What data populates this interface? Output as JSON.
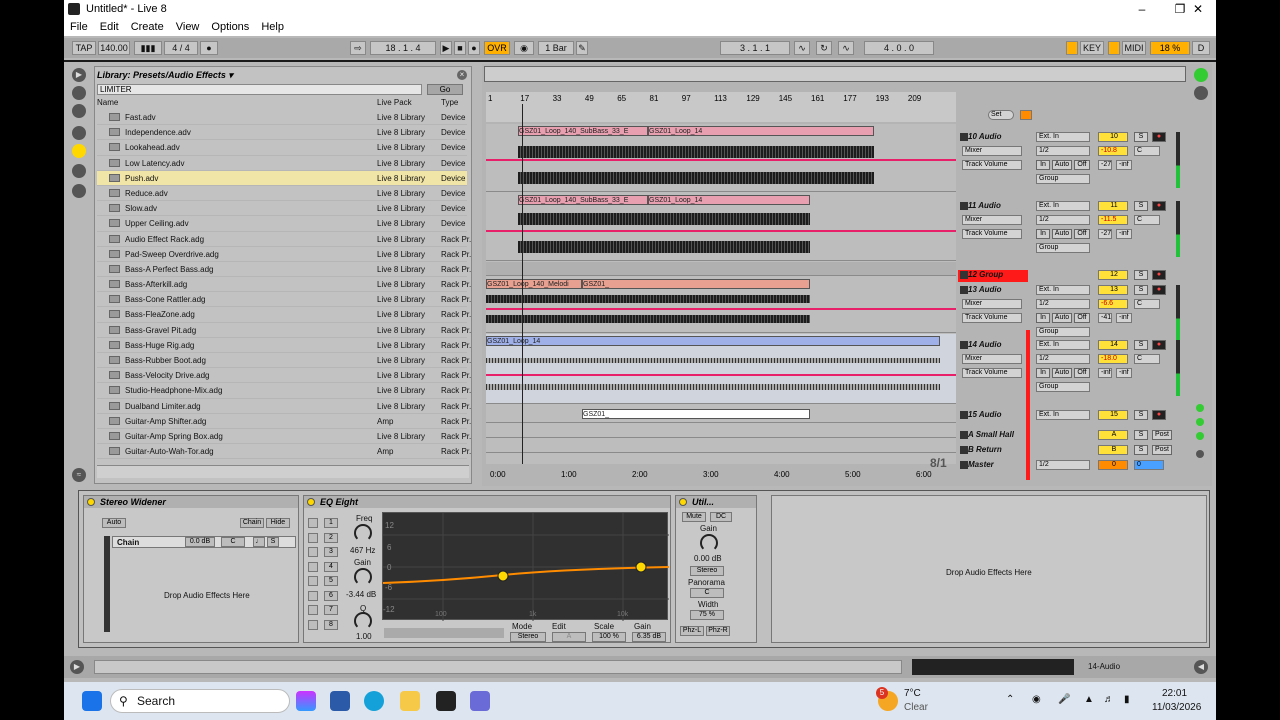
{
  "window": {
    "title": "Untitled* - Live 8"
  },
  "menu": [
    "File",
    "Edit",
    "Create",
    "View",
    "Options",
    "Help"
  ],
  "transport": {
    "tap": "TAP",
    "tempo": "140.00",
    "sig": "4 / 4",
    "pos": "18 . 1 . 4",
    "ovr": "OVR",
    "quant": "1 Bar",
    "loop_start": "3 . 1 . 1",
    "loop_len": "4 . 0 . 0",
    "key": "KEY",
    "midi": "MIDI",
    "cpu": "18 %",
    "d": "D"
  },
  "browser": {
    "title": "Library: Presets/Audio Effects ▾",
    "search": "LIMITER",
    "go": "Go",
    "col_name": "Name",
    "col_pack": "Live Pack",
    "col_type": "Type",
    "rows": [
      {
        "name": "Fast.adv",
        "pack": "Live 8 Library",
        "type": "Device"
      },
      {
        "name": "Independence.adv",
        "pack": "Live 8 Library",
        "type": "Device"
      },
      {
        "name": "Lookahead.adv",
        "pack": "Live 8 Library",
        "type": "Device"
      },
      {
        "name": "Low Latency.adv",
        "pack": "Live 8 Library",
        "type": "Device"
      },
      {
        "name": "Push.adv",
        "pack": "Live 8 Library",
        "type": "Device"
      },
      {
        "name": "Reduce.adv",
        "pack": "Live 8 Library",
        "type": "Device"
      },
      {
        "name": "Slow.adv",
        "pack": "Live 8 Library",
        "type": "Device"
      },
      {
        "name": "Upper Ceiling.adv",
        "pack": "Live 8 Library",
        "type": "Device"
      },
      {
        "name": "Audio Effect Rack.adg",
        "pack": "Live 8 Library",
        "type": "Rack Pr."
      },
      {
        "name": "Pad-Sweep Overdrive.adg",
        "pack": "Live 8 Library",
        "type": "Rack Pr."
      },
      {
        "name": "Bass-A Perfect Bass.adg",
        "pack": "Live 8 Library",
        "type": "Rack Pr."
      },
      {
        "name": "Bass-Afterkill.adg",
        "pack": "Live 8 Library",
        "type": "Rack Pr."
      },
      {
        "name": "Bass-Cone Rattler.adg",
        "pack": "Live 8 Library",
        "type": "Rack Pr."
      },
      {
        "name": "Bass-FleaZone.adg",
        "pack": "Live 8 Library",
        "type": "Rack Pr."
      },
      {
        "name": "Bass-Gravel Pit.adg",
        "pack": "Live 8 Library",
        "type": "Rack Pr."
      },
      {
        "name": "Bass-Huge Rig.adg",
        "pack": "Live 8 Library",
        "type": "Rack Pr."
      },
      {
        "name": "Bass-Rubber Boot.adg",
        "pack": "Live 8 Library",
        "type": "Rack Pr."
      },
      {
        "name": "Bass-Velocity Drive.adg",
        "pack": "Live 8 Library",
        "type": "Rack Pr."
      },
      {
        "name": "Studio-Headphone-Mix.adg",
        "pack": "Live 8 Library",
        "type": "Rack Pr."
      },
      {
        "name": "Dualband Limiter.adg",
        "pack": "Live 8 Library",
        "type": "Rack Pr."
      },
      {
        "name": "Guitar-Amp Shifter.adg",
        "pack": "Amp",
        "type": "Rack Pr."
      },
      {
        "name": "Guitar-Amp Spring Box.adg",
        "pack": "Live 8 Library",
        "type": "Rack Pr."
      },
      {
        "name": "Guitar-Auto-Wah-Tor.adg",
        "pack": "Amp",
        "type": "Rack Pr."
      }
    ]
  },
  "ruler": [
    "1",
    "17",
    "33",
    "49",
    "65",
    "81",
    "97",
    "113",
    "129",
    "145",
    "161",
    "177",
    "193",
    "209"
  ],
  "timeline": [
    "0:00",
    "1:00",
    "2:00",
    "3:00",
    "4:00",
    "5:00",
    "6:00"
  ],
  "zoom": "8/1",
  "set": "Set",
  "clips": {
    "t10": "GSZ01_Loop_140_SubBass_33_E",
    "t10b": "GSZ01_Loop_14",
    "t13": "GSZ01_Loop_140_Melodi",
    "t13b": "GSZ01_",
    "t14": "GSZ01_Loop_14",
    "t15": "GSZ01_"
  },
  "tracks": [
    {
      "name": "10 Audio",
      "input": "Ext. In",
      "chan": "1/2",
      "mixer": "Mixer",
      "auto": "Track Volume",
      "num": "10",
      "vol": "-10.8",
      "pan": "C",
      "send": "-27",
      "send2": "-inf"
    },
    {
      "name": "11 Audio",
      "input": "Ext. In",
      "chan": "1/2",
      "mixer": "Mixer",
      "auto": "Track Volume",
      "num": "11",
      "vol": "-11.5",
      "pan": "C",
      "send": "-27",
      "send2": "-inf"
    },
    {
      "name": "12 Group",
      "num": "12"
    },
    {
      "name": "13 Audio",
      "input": "Ext. In",
      "chan": "1/2",
      "mixer": "Mixer",
      "auto": "Track Volume",
      "num": "13",
      "vol": "-6.6",
      "pan": "C",
      "send": "-41",
      "send2": "-inf"
    },
    {
      "name": "14 Audio",
      "input": "Ext. In",
      "chan": "1/2",
      "mixer": "Mixer",
      "auto": "Track Volume",
      "num": "14",
      "vol": "-18.0",
      "pan": "C",
      "send": "-inf",
      "send2": "-inf"
    },
    {
      "name": "15 Audio",
      "input": "Ext. In",
      "num": "15"
    },
    {
      "name": "A Small Hall",
      "num": "A",
      "post": "Post"
    },
    {
      "name": "B Return",
      "num": "B",
      "post": "Post"
    },
    {
      "name": "Master",
      "chan": "1/2",
      "num": "0",
      "pan": "0"
    }
  ],
  "mixer_labels": {
    "in": "In",
    "auto": "Auto",
    "off": "Off",
    "group": "Group",
    "s": "S",
    "c": "C"
  },
  "devices": {
    "widener": {
      "title": "Stereo Widener",
      "auto": "Auto",
      "chain_btn": "Chain",
      "hide": "Hide",
      "chain": "Chain",
      "chain_vol": "0.0 dB",
      "chain_pan": "C",
      "drop": "Drop Audio Effects Here"
    },
    "eq": {
      "title": "EQ Eight",
      "freq_label": "Freq",
      "freq": "467 Hz",
      "gain_label": "Gain",
      "gain": "-3.44 dB",
      "q_label": "Q",
      "q": "1.00",
      "bands": [
        "1",
        "2",
        "3",
        "4",
        "5",
        "6",
        "7",
        "8"
      ],
      "mode_label": "Mode",
      "mode": "Stereo",
      "edit_label": "Edit",
      "edit": "A",
      "scale_label": "Scale",
      "scale": "100 %",
      "outgain_label": "Gain",
      "outgain": "6.35 dB",
      "y_ticks": [
        "12",
        "6",
        "0",
        "-6",
        "-12"
      ],
      "x_ticks": [
        "100",
        "1k",
        "10k"
      ]
    },
    "utility": {
      "title": "Util...",
      "mute": "Mute",
      "dc": "DC",
      "gain_label": "Gain",
      "gain": "0.00 dB",
      "stereo": "Stereo",
      "panorama": "Panorama",
      "pan": "C",
      "width_label": "Width",
      "width": "75 %",
      "phzl": "Phz-L",
      "phzr": "Phz-R"
    },
    "drop": "Drop Audio Effects Here"
  },
  "status": {
    "track": "14-Audio"
  },
  "taskbar": {
    "search": "Search",
    "temp": "7°C",
    "weather": "Clear",
    "badge": "5",
    "time": "22:01",
    "date": "11/03/2026"
  }
}
